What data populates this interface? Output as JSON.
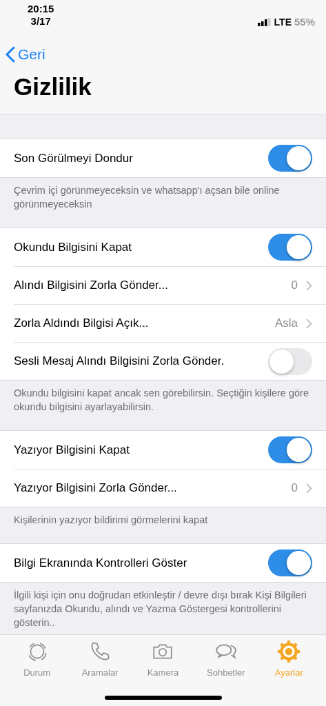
{
  "status_bar": {
    "time": "20:15",
    "date": "3/17",
    "network": "LTE",
    "battery": "55%"
  },
  "nav": {
    "back": "Geri",
    "title": "Gizlilik"
  },
  "sections": [
    {
      "rows": [
        {
          "kind": "toggle",
          "label": "Son Görülmeyi Dondur",
          "on": true
        }
      ],
      "footer": "Çevrim içi görünmeyeceksin ve whatsapp'ı açsan bile online görünmeyeceksin"
    },
    {
      "rows": [
        {
          "kind": "toggle",
          "label": "Okundu Bilgisini Kapat",
          "on": true
        },
        {
          "kind": "link",
          "label": "Alındı Bilgisini Zorla Gönder...",
          "value": "0"
        },
        {
          "kind": "link",
          "label": "Zorla Aldındı Bilgisi Açık...",
          "value": "Asla"
        },
        {
          "kind": "toggle",
          "label": "Sesli Mesaj Alındı Bilgisini Zorla Gönder.",
          "on": false
        }
      ],
      "footer": "Okundu bilgisini kapat ancak sen görebilirsin. Seçtiğin kişilere göre okundu bilgisini ayarlayabilirsin."
    },
    {
      "rows": [
        {
          "kind": "toggle",
          "label": "Yazıyor Bilgisini Kapat",
          "on": true
        },
        {
          "kind": "link",
          "label": "Yazıyor Bilgisini Zorla Gönder...",
          "value": "0"
        }
      ],
      "footer": "Kişilerinin yazıyor bildirimi görmelerini kapat"
    },
    {
      "rows": [
        {
          "kind": "toggle",
          "label": "Bilgi Ekranında Kontrolleri Göster",
          "on": true
        }
      ],
      "footer": "İlgili kişi için onu doğrudan etkinleştir / devre dışı bırak Kişi Bilgileri sayfanızda Okundu, alındı ve Yazma Göstergesi kontrollerini gösterin.."
    }
  ],
  "tab_bar": [
    {
      "label": "Durum",
      "selected": false
    },
    {
      "label": "Aramalar",
      "selected": false
    },
    {
      "label": "Kamera",
      "selected": false
    },
    {
      "label": "Sohbetler",
      "selected": false
    },
    {
      "label": "Ayarlar",
      "selected": true
    }
  ]
}
